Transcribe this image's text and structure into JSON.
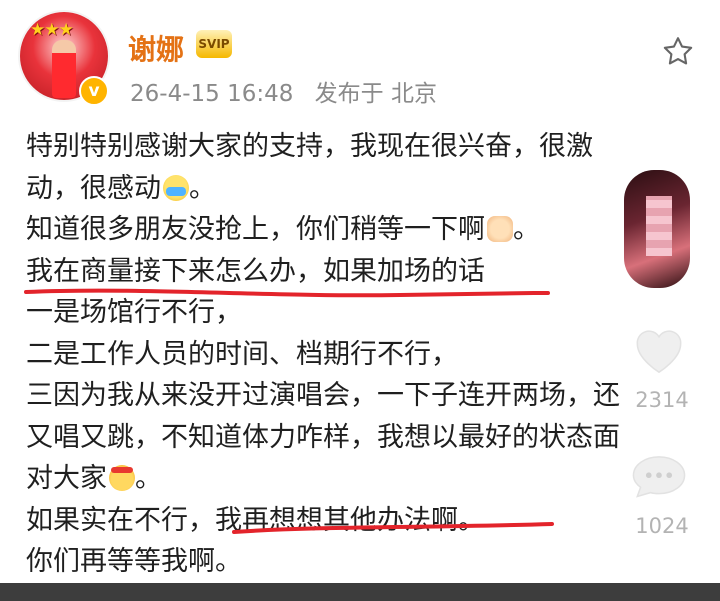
{
  "header": {
    "name": "谢娜",
    "svip_icon": "svip-crown-icon",
    "verified_icon": "verified-v-icon",
    "date": "26-4-15 16:48",
    "location": "发布于 北京",
    "favorite_icon": "star-outline-icon"
  },
  "post": {
    "lines": [
      "特别特别感谢大家的支持，我现在很兴奋，很激",
      "动，很感动",
      "知道很多朋友没抢上，你们稍等一下啊",
      "我在商量接下来怎么办，如果加场的话",
      "一是场馆行不行，",
      "二是工作人员的时间、档期行不行，",
      "三因为我从来没开过演唱会，一下子连开两场，还",
      "又唱又跳，不知道体力咋样，我想以最好的状态面",
      "对大家",
      "如果实在不行，我再想想其他办法啊。",
      "你们再等等我啊。"
    ],
    "line2_end": "。",
    "line3_end": "。",
    "line9_end": "。",
    "emojis": [
      "crying-emoji",
      "fist-emoji",
      "headband-emoji"
    ],
    "underline_color": "#e3242b"
  },
  "side": {
    "like_count": "2314",
    "comment_count": "1024",
    "heart_icon": "heart-icon",
    "comment_icon": "comment-bubble-icon"
  }
}
